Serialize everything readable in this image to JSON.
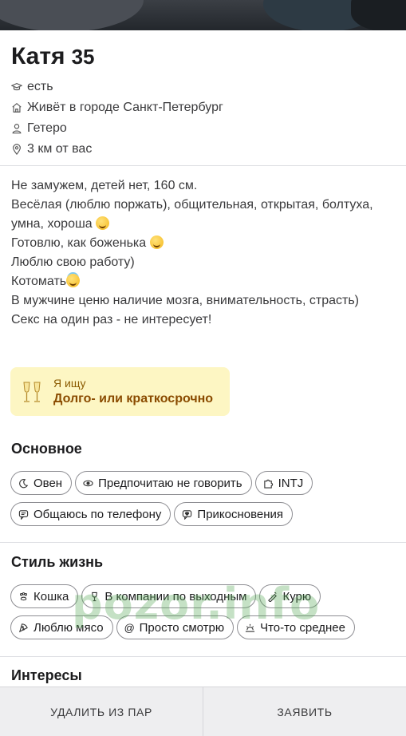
{
  "profile": {
    "name": "Катя",
    "age": "35",
    "facts": [
      {
        "icon": "graduation-cap-icon",
        "text": "есть"
      },
      {
        "icon": "home-icon",
        "text": "Живёт в городе Санкт-Петербург"
      },
      {
        "icon": "person-icon",
        "text": "Гетеро"
      },
      {
        "icon": "location-pin-icon",
        "text": "3 км от вас"
      }
    ],
    "about_lines": [
      "Не замужем, детей нет, 160 см.",
      "Весёлая (люблю поржать), общительная, открытая, болтуха,",
      "умна, хороша",
      "Готовлю, как боженька",
      "Люблю свою работу)",
      "Котомать",
      "В мужчине ценю наличие мозга, внимательность, страсть)",
      "Секс на один раз - не интересует!"
    ]
  },
  "looking_for": {
    "label": "Я ищу",
    "value": "Долго- или краткосрочно",
    "icon": "champagne-glasses-icon"
  },
  "basics": {
    "title": "Основное",
    "chips": [
      {
        "icon": "moon-icon",
        "label": "Овен"
      },
      {
        "icon": "eye-icon",
        "label": "Предпочитаю не говорить"
      },
      {
        "icon": "puzzle-icon",
        "label": "INTJ"
      },
      {
        "icon": "chat-icon",
        "label": "Общаюсь по телефону"
      },
      {
        "icon": "heart-chat-icon",
        "label": "Прикосновения"
      }
    ]
  },
  "lifestyle": {
    "title": "Стиль жизнь",
    "chips": [
      {
        "icon": "paw-icon",
        "label": "Кошка"
      },
      {
        "icon": "glass-icon",
        "label": "В компании по выходным"
      },
      {
        "icon": "cigarette-icon",
        "label": "Курю"
      },
      {
        "icon": "pizza-icon",
        "label": "Люблю мясо"
      },
      {
        "icon": "at-icon",
        "label": "Просто смотрю"
      },
      {
        "icon": "sunrise-icon",
        "label": "Что-то среднее"
      }
    ]
  },
  "interests": {
    "title": "Интересы"
  },
  "actions": {
    "remove_label": "УДАЛИТЬ ИЗ ПАР",
    "report_label": "ЗАЯВИТЬ"
  },
  "watermark": "pozor.info",
  "colors": {
    "looking_bg": "#fdf6c3",
    "looking_text": "#8a4b00",
    "chip_border": "#8e8e93",
    "bottom_bar": "#eeeef0"
  }
}
